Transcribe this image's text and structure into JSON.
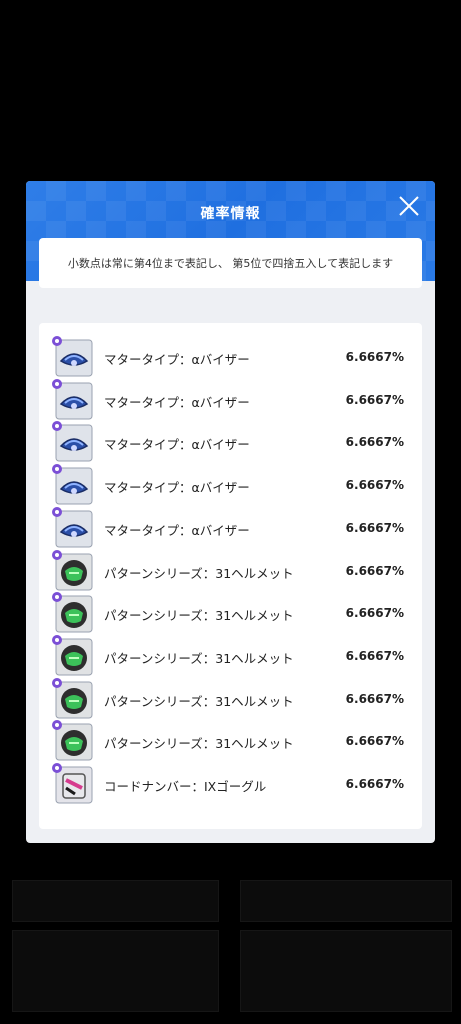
{
  "dialog": {
    "title": "確率情報",
    "close_icon": "close-icon",
    "notice": "小数点は常に第4位まで表記し、 第5位で四捨五入して表記します"
  },
  "items": [
    {
      "name": "マタータイプ：αバイザー",
      "rate": "6.6667%",
      "icon": "visor-icon"
    },
    {
      "name": "マタータイプ：αバイザー",
      "rate": "6.6667%",
      "icon": "visor-icon"
    },
    {
      "name": "マタータイプ：αバイザー",
      "rate": "6.6667%",
      "icon": "visor-icon"
    },
    {
      "name": "マタータイプ：αバイザー",
      "rate": "6.6667%",
      "icon": "visor-icon"
    },
    {
      "name": "マタータイプ：αバイザー",
      "rate": "6.6667%",
      "icon": "visor-icon"
    },
    {
      "name": "パターンシリーズ：31ヘルメット",
      "rate": "6.6667%",
      "icon": "helmet-icon"
    },
    {
      "name": "パターンシリーズ：31ヘルメット",
      "rate": "6.6667%",
      "icon": "helmet-icon"
    },
    {
      "name": "パターンシリーズ：31ヘルメット",
      "rate": "6.6667%",
      "icon": "helmet-icon"
    },
    {
      "name": "パターンシリーズ：31ヘルメット",
      "rate": "6.6667%",
      "icon": "helmet-icon"
    },
    {
      "name": "パターンシリーズ：31ヘルメット",
      "rate": "6.6667%",
      "icon": "helmet-icon"
    },
    {
      "name": "コードナンバー：IXゴーグル",
      "rate": "6.6667%",
      "icon": "goggle-icon"
    }
  ],
  "colors": {
    "header_blue": "#1f6fe0",
    "badge_purple": "#7b4fd6"
  }
}
